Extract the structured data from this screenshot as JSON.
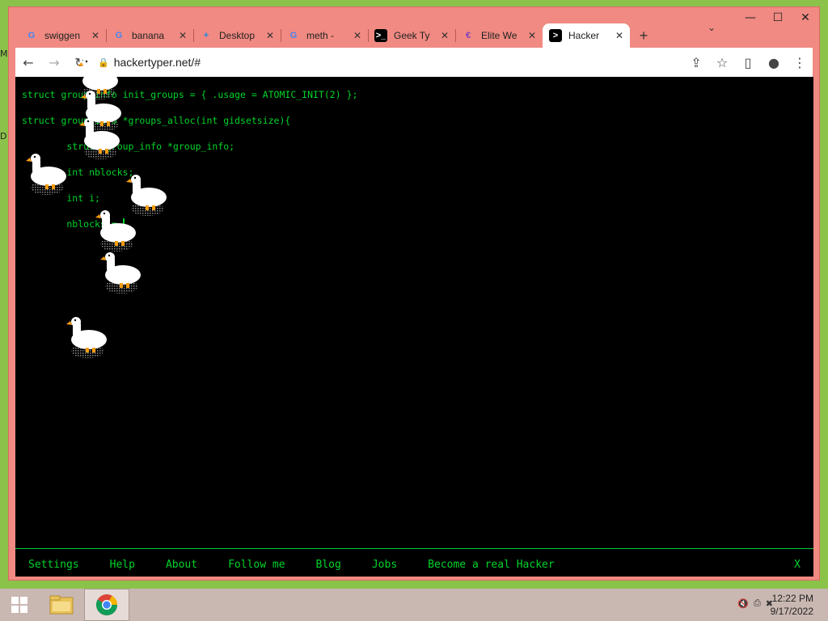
{
  "desktop": {
    "edge_letters": [
      "M",
      "D"
    ]
  },
  "window_controls": {
    "minimize": "—",
    "maximize": "☐",
    "close": "✕"
  },
  "tabs": [
    {
      "title": "swiggen",
      "favicon": "google-icon",
      "favicon_text": "G",
      "favicon_color": "#4285f4",
      "active": false
    },
    {
      "title": "banana",
      "favicon": "google-icon",
      "favicon_text": "G",
      "favicon_color": "#4285f4",
      "active": false
    },
    {
      "title": "Desktop",
      "favicon": "desktop-app-icon",
      "favicon_text": "+",
      "favicon_color": "#1e88e5",
      "active": false
    },
    {
      "title": "meth - ",
      "favicon": "google-icon",
      "favicon_text": "G",
      "favicon_color": "#4285f4",
      "active": false
    },
    {
      "title": "Geek Ty",
      "favicon": "terminal-icon",
      "favicon_text": ">_",
      "favicon_color": "#000000",
      "active": false
    },
    {
      "title": "Elite We",
      "favicon": "elite-icon",
      "favicon_text": "€",
      "favicon_color": "#7b3fbf",
      "active": false
    },
    {
      "title": "Hacker",
      "favicon": "hacker-icon",
      "favicon_text": ">",
      "favicon_color": "#000000",
      "active": true
    }
  ],
  "tab_close_glyph": "✕",
  "newtab_glyph": "+",
  "tabdrop_glyph": "⌄",
  "toolbar": {
    "back": "←",
    "forward": "→",
    "reload": "↻",
    "lock": "🔒",
    "url": "hackertyper.net/#",
    "share": "⇪",
    "bookmark": "☆",
    "sidepanel": "▯",
    "profile": "●",
    "menu": "⋮"
  },
  "code_lines": [
    "struct group_info init_groups = { .usage = ATOMIC_INIT(2) };",
    "",
    "struct group_info *groups_alloc(int gidsetsize){",
    "",
    "        struct group_info *group_info;",
    "",
    "        int nblocks;",
    "",
    "        int i;",
    "",
    "",
    "",
    "        nblocks = "
  ],
  "footer": {
    "links": [
      "Settings",
      "Help",
      "About",
      "Follow me",
      "Blog",
      "Jobs",
      "Become a real Hacker"
    ],
    "close": "X"
  },
  "taskbar": {
    "time": "12:22 PM",
    "date": "9/17/2022",
    "tray": [
      "🔇",
      "⎙",
      "✖"
    ]
  },
  "colors": {
    "terminal_green": "#00d42a",
    "window_frame": "#f08a82",
    "taskbar": "#c9b7b1"
  }
}
